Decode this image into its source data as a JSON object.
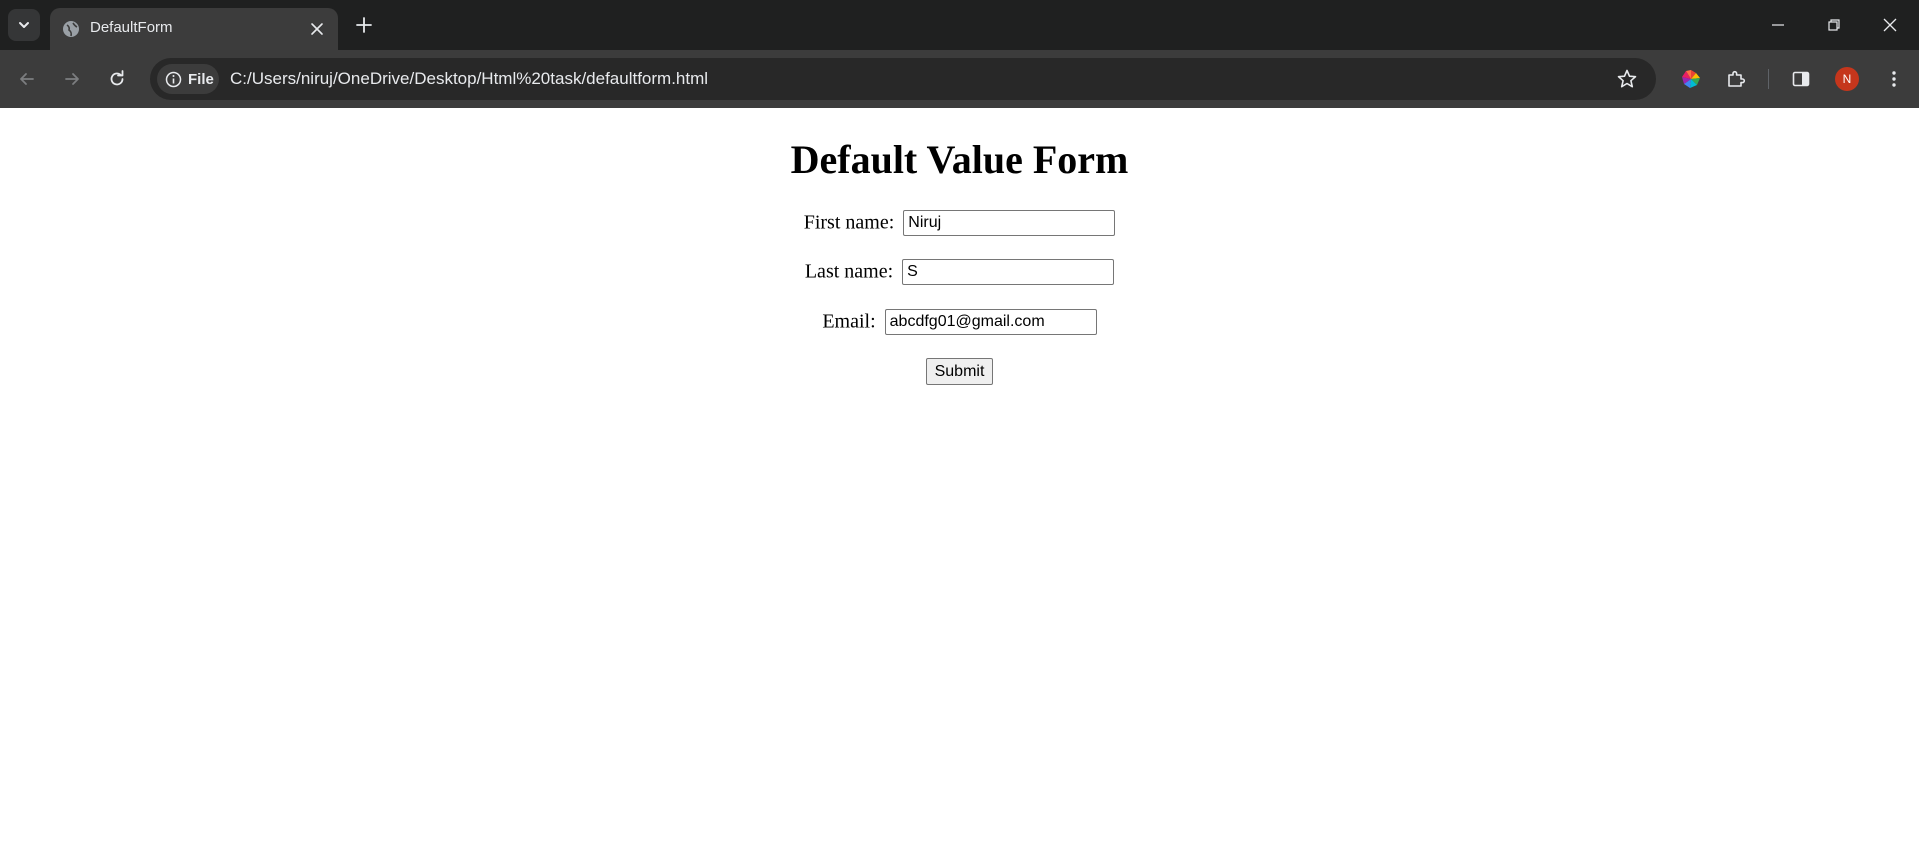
{
  "browser": {
    "tab": {
      "title": "DefaultForm"
    },
    "omnibox": {
      "chip_label": "File",
      "url": "C:/Users/niruj/OneDrive/Desktop/Html%20task/defaultform.html"
    },
    "profile_initial": "N"
  },
  "page": {
    "title": "Default Value Form",
    "fields": {
      "first_name": {
        "label": "First name:",
        "value": "Niruj"
      },
      "last_name": {
        "label": "Last name:",
        "value": "S"
      },
      "email": {
        "label": "Email:",
        "value": "abcdfg01@gmail.com"
      }
    },
    "submit_label": "Submit"
  },
  "colors": {
    "tabstrip_bg": "#1f2020",
    "toolbar_bg": "#3c3c3c",
    "omnibox_bg": "#282828",
    "avatar_bg": "#c5361c"
  }
}
